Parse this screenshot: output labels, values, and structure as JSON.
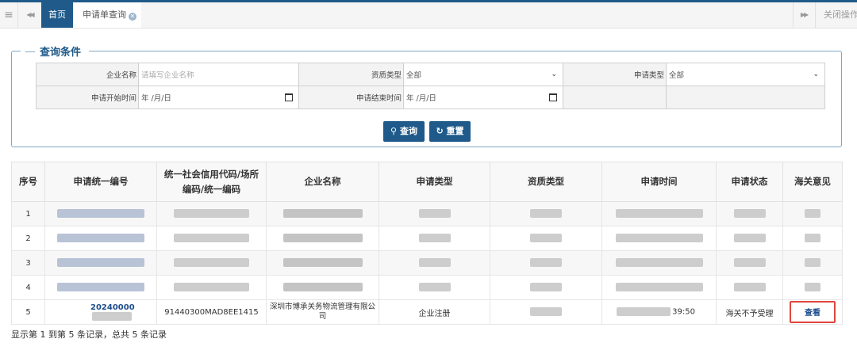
{
  "tabs": {
    "menu_icon": "≡",
    "prev_icon": "◀◀",
    "next_icon": "▶▶",
    "home": "首页",
    "query": "申请单查询",
    "close_ops": "关闭操作"
  },
  "search": {
    "legend": "查询条件",
    "company_label": "企业名称",
    "company_placeholder": "请填写企业名称",
    "qual_label": "资质类型",
    "qual_value": "全部",
    "apptype_label": "申请类型",
    "apptype_value": "全部",
    "start_label": "申请开始时间",
    "start_value": "年 /月/日",
    "end_label": "申请结束时间",
    "end_value": "年 /月/日",
    "query_btn": "查询",
    "reset_btn": "重置"
  },
  "table": {
    "headers": [
      "序号",
      "申请统一编号",
      "统一社会信用代码/场所编码/统一编码",
      "企业名称",
      "申请类型",
      "资质类型",
      "申请时间",
      "申请状态",
      "海关意见"
    ],
    "rows": [
      {
        "no": "1"
      },
      {
        "no": "2"
      },
      {
        "no": "3"
      },
      {
        "no": "4"
      },
      {
        "no": "5",
        "app_no": "20240000",
        "credit_code": "91440300MAD8EE1415",
        "company": "深圳市博承关务物流管理有限公司",
        "app_type": "企业注册",
        "time_tail": "39:50",
        "status": "海关不予受理",
        "opinion": "查看"
      }
    ]
  },
  "footer": "显示第 1 到第 5 条记录，总共 5 条记录",
  "colors": {
    "primary": "#1f5a8a",
    "highlight": "#e0463c"
  }
}
